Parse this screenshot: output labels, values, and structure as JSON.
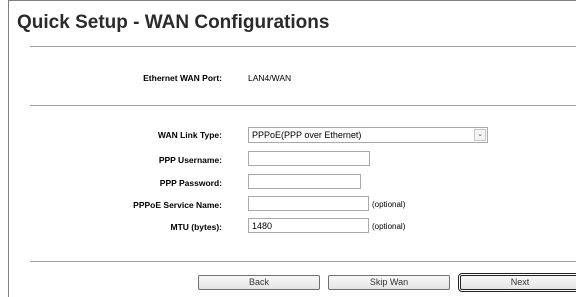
{
  "page": {
    "title": "Quick Setup - WAN Configurations"
  },
  "port": {
    "label": "Ethernet WAN Port:",
    "value": "LAN4/WAN"
  },
  "form": {
    "link_type": {
      "label": "WAN Link Type:",
      "value": "PPPoE(PPP over Ethernet)",
      "arrow": "⌄"
    },
    "username": {
      "label": "PPP Username:",
      "value": ""
    },
    "password": {
      "label": "PPP Password:",
      "value": ""
    },
    "service_name": {
      "label": "PPPoE Service Name:",
      "value": "",
      "note": "(optional)"
    },
    "mtu": {
      "label": "MTU (bytes):",
      "value": "1480",
      "note": "(optional)"
    }
  },
  "buttons": {
    "back": "Back",
    "skip": "Skip Wan",
    "next": "Next"
  }
}
